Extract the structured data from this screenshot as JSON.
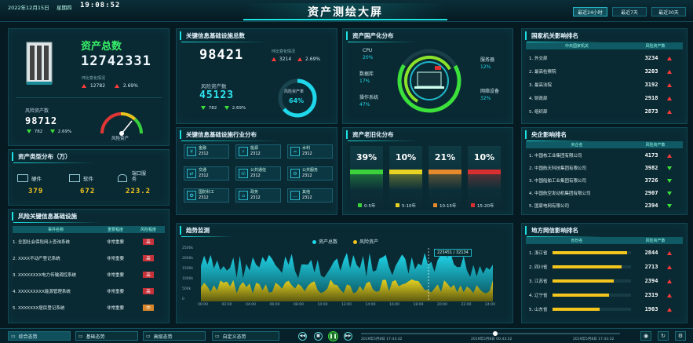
{
  "header": {
    "date": "2022年12月15日",
    "weekday": "星期四",
    "time": "19:08:52",
    "title": "资产测绘大屏",
    "ranges": [
      "最近24小时",
      "最近7天",
      "最近30天"
    ]
  },
  "asset_total": {
    "title": "资产总数",
    "value": "12742331",
    "sub_label": "环比变化情况",
    "change_count": "12782",
    "change_pct": "2.69%",
    "risk_label": "风险资产数",
    "risk_value": "98712",
    "risk_count": "782",
    "risk_pct": "2.69%",
    "gauge_label": "风险资产"
  },
  "asset_types": {
    "title": "资产类型分布（万）",
    "items": [
      {
        "label": "硬件",
        "value": "379"
      },
      {
        "label": "软件",
        "value": "672"
      },
      {
        "label": "端口服务",
        "value": "223.2"
      }
    ]
  },
  "risk_infra": {
    "title": "风险关键信息基础设施",
    "headers": [
      "事件名称",
      "重要程度",
      "风险程度"
    ],
    "rows": [
      {
        "name": "1. 全国社会保险网上查询系统",
        "importance": "非常重要",
        "risk": "高"
      },
      {
        "name": "2. XXXX不动产登记系统",
        "importance": "非常重要",
        "risk": "高"
      },
      {
        "name": "3. XXXXXXXX电力传输调控系统",
        "importance": "非常重要",
        "risk": "高"
      },
      {
        "name": "4. XXXXXXXXX能源管理系统",
        "importance": "非常重要",
        "risk": "高"
      },
      {
        "name": "5. XXXXXXX居民登记系统",
        "importance": "非常重要",
        "risk": "中"
      }
    ]
  },
  "key_infra": {
    "title": "关键信息基础设施总数",
    "value": "98421",
    "sub_label": "环比变化情况",
    "change_count": "3214",
    "change_pct": "2.69%",
    "risk_label": "风险资产数",
    "risk_value": "45123",
    "risk_count": "782",
    "risk_pct": "2.69%",
    "ring_label": "风险资产率",
    "ring_value": "64%",
    "ring_fraction": 0.64
  },
  "industry": {
    "title": "关键信息基础设施行业分布",
    "tiles": [
      {
        "label": "金融",
        "value": "2312"
      },
      {
        "label": "能源",
        "value": "2312"
      },
      {
        "label": "水利",
        "value": "2312"
      },
      {
        "label": "交通",
        "value": "2312"
      },
      {
        "label": "公共通信",
        "value": "2312"
      },
      {
        "label": "公共服务",
        "value": "2312"
      },
      {
        "label": "国防科工",
        "value": "2312"
      },
      {
        "label": "政务",
        "value": "2312"
      },
      {
        "label": "其他",
        "value": "2312"
      }
    ]
  },
  "localization": {
    "title": "资产国产化分布",
    "items": [
      {
        "label": "CPU",
        "value": "20%"
      },
      {
        "label": "数据库",
        "value": "17%"
      },
      {
        "label": "操作系统",
        "value": "47%"
      },
      {
        "label": "服务器",
        "value": "12%"
      },
      {
        "label": "网络设备",
        "value": "32%"
      }
    ]
  },
  "aging": {
    "title": "资产老旧化分布",
    "values": [
      "39%",
      "10%",
      "21%",
      "10%"
    ],
    "legend": [
      "0-5年",
      "5-10年",
      "10-15年",
      "15-20年"
    ],
    "colors": [
      "#3bd13b",
      "#e8d323",
      "#e5892a",
      "#d83030"
    ]
  },
  "trend": {
    "title": "趋势监测",
    "legend": [
      "资产总数",
      "风险资产"
    ],
    "tooltip": "223451 / 32134",
    "y_ticks": [
      "2500k",
      "2000k",
      "1500k",
      "1000k",
      "500k",
      "0"
    ],
    "x_ticks": [
      "00:00",
      "02:00",
      "04:00",
      "06:00",
      "08:00",
      "10:00",
      "12:00",
      "14:00",
      "16:00",
      "18:00",
      "20:00",
      "22:00",
      "24:00"
    ]
  },
  "ministry_rank": {
    "title": "国家机关影响排名",
    "headers": [
      "中央国家机关",
      "风险资产数"
    ],
    "rows": [
      {
        "name": "1. 外交部",
        "value": "3234",
        "dir": "up"
      },
      {
        "name": "2. 最高检察院",
        "value": "3203",
        "dir": "up"
      },
      {
        "name": "3. 最高法院",
        "value": "3192",
        "dir": "up"
      },
      {
        "name": "4. 财政部",
        "value": "2918",
        "dir": "up"
      },
      {
        "name": "5. 组织部",
        "value": "2873",
        "dir": "up"
      }
    ]
  },
  "soe_rank": {
    "title": "央企影响排名",
    "headers": [
      "央企名",
      "风险资产数"
    ],
    "rows": [
      {
        "name": "1. 中国核工业集团有限公司",
        "value": "4173",
        "dir": "up"
      },
      {
        "name": "2. 中国航天科技集团有限公司",
        "value": "3982",
        "dir": "dn"
      },
      {
        "name": "3. 中国船舶工业集团有限公司",
        "value": "3726",
        "dir": "dn"
      },
      {
        "name": "4. 中国航空发动机集团有限公司",
        "value": "2907",
        "dir": "dn"
      },
      {
        "name": "5. 国家电网有限公司",
        "value": "2394",
        "dir": "dn"
      }
    ]
  },
  "region_rank": {
    "title": "地方网信影响排名",
    "headers": [
      "省份名",
      "风险资产数"
    ],
    "rows": [
      {
        "name": "1. 浙江省",
        "value": "2844",
        "dir": "up",
        "fill": 0.95
      },
      {
        "name": "2. 四川省",
        "value": "2713",
        "dir": "up",
        "fill": 0.88
      },
      {
        "name": "3. 江苏省",
        "value": "2394",
        "dir": "up",
        "fill": 0.78
      },
      {
        "name": "4. 辽宁省",
        "value": "2319",
        "dir": "up",
        "fill": 0.72
      },
      {
        "name": "5. 山东省",
        "value": "1903",
        "dir": "up",
        "fill": 0.6
      }
    ]
  },
  "footer": {
    "tabs": [
      "综合态势",
      "基础态势",
      "高级态势",
      "自定义态势"
    ],
    "times": [
      "2019年5月8日 17:43:32",
      "2019年5月8日 00:43:32",
      "2019年5月8日 17:43:32"
    ]
  }
}
